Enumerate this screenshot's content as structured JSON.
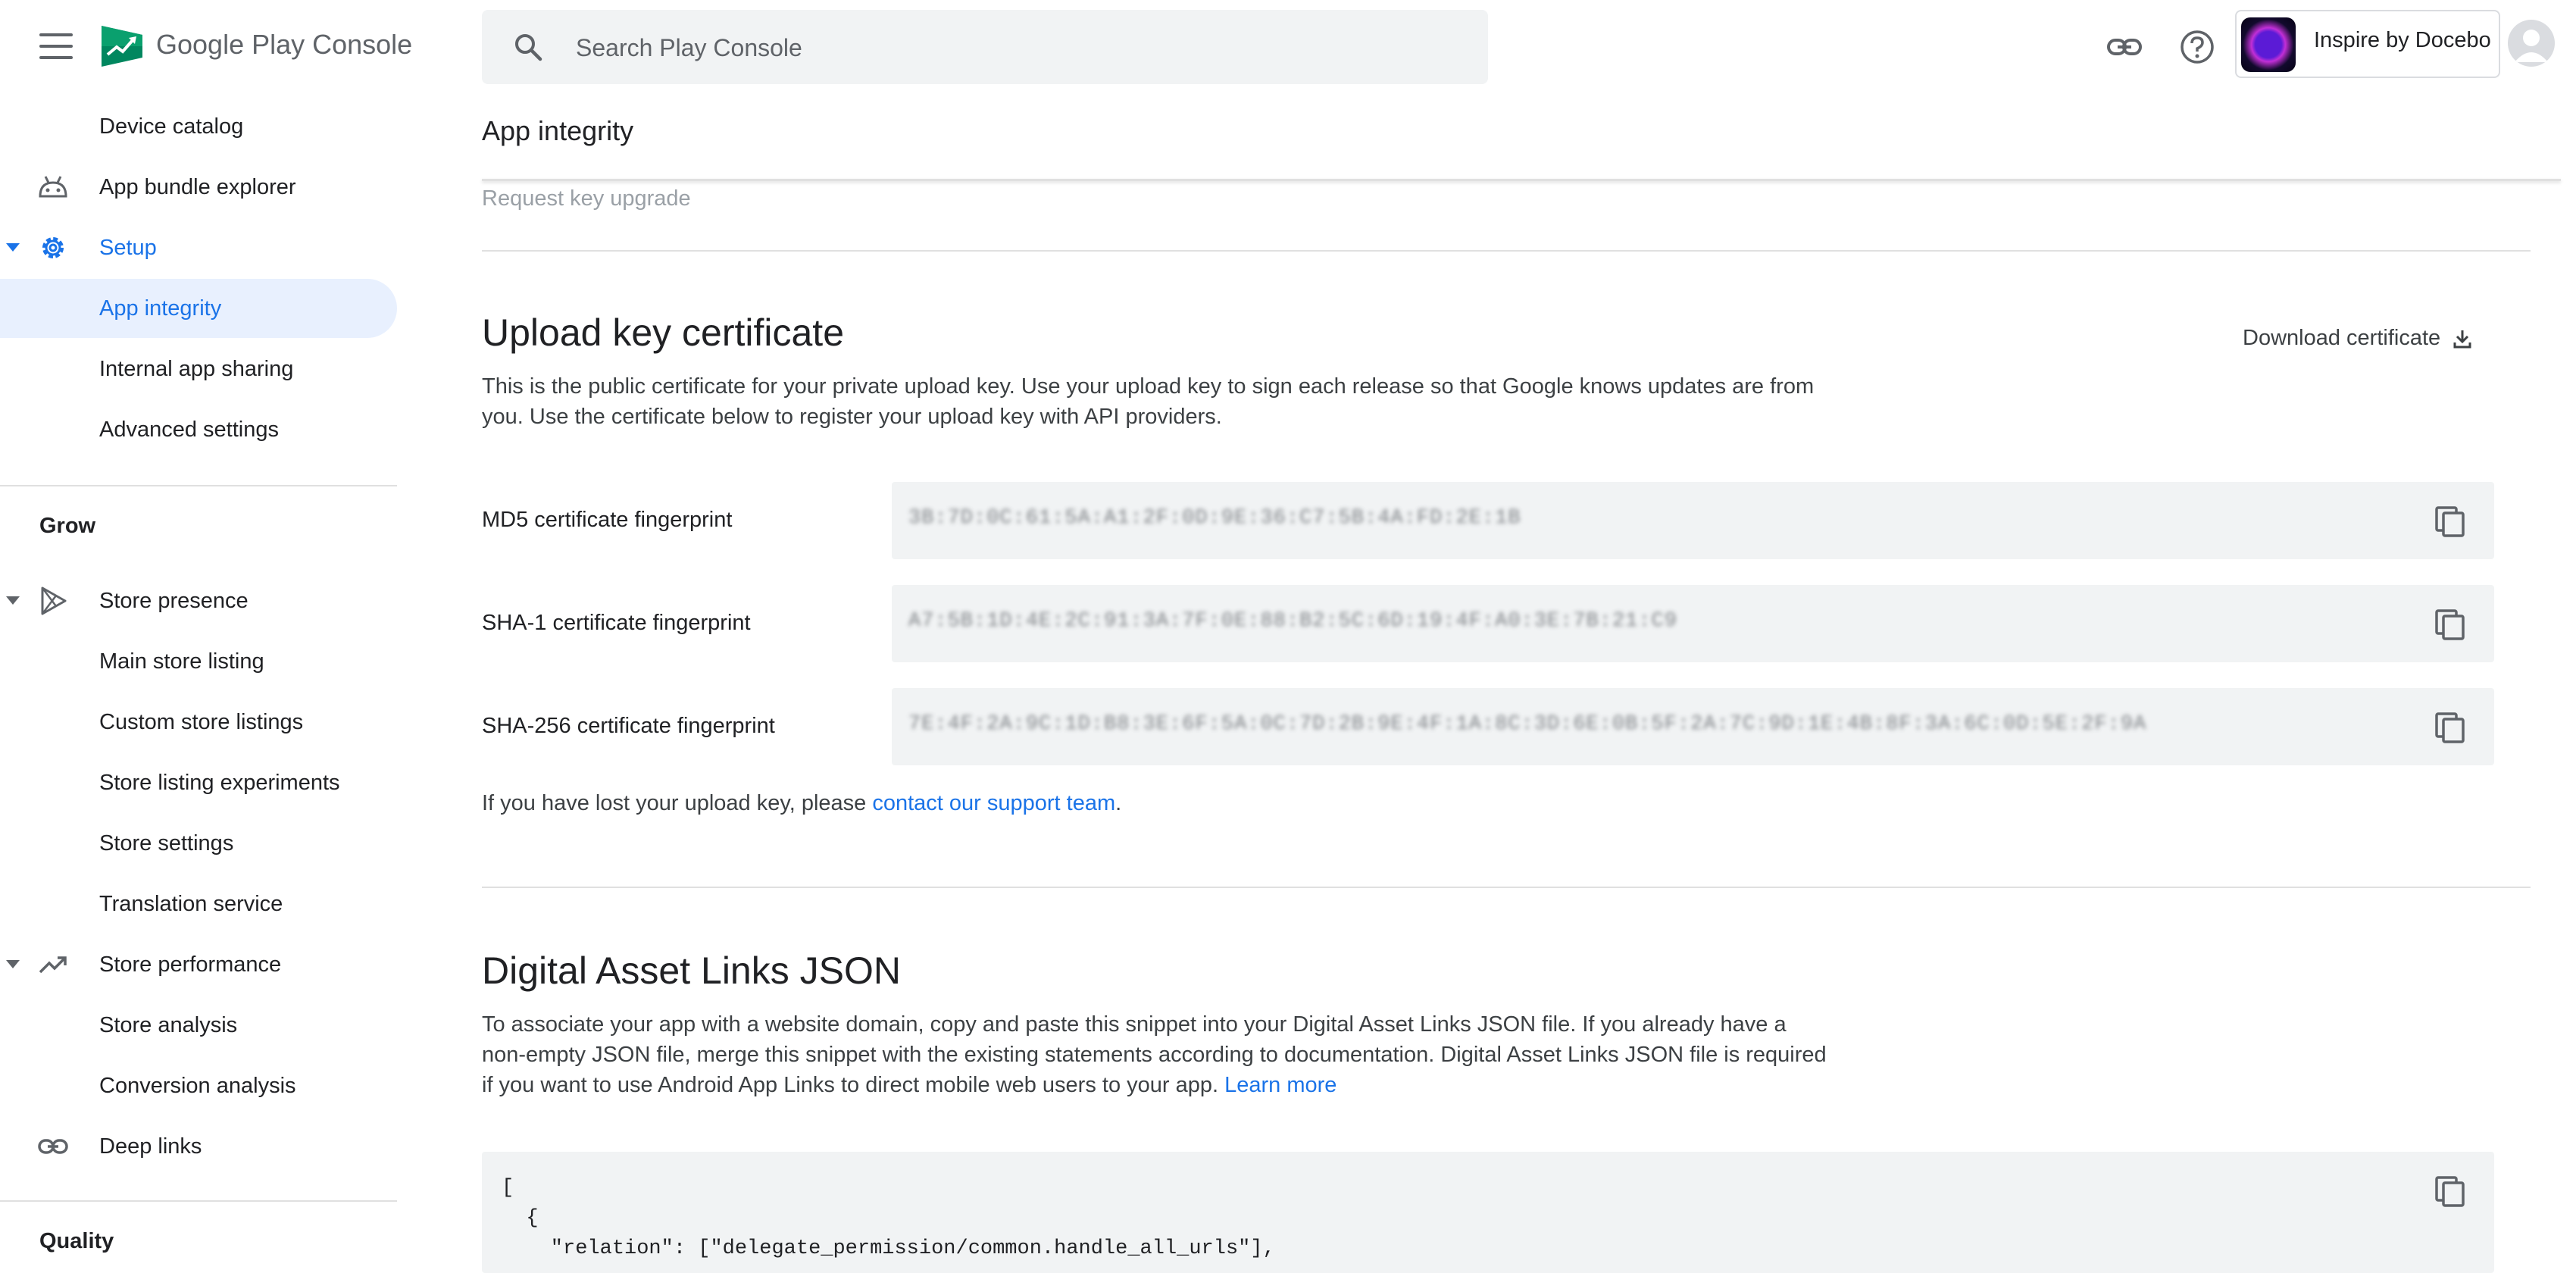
{
  "brand": {
    "name": "Google Play Console"
  },
  "sidebar": {
    "items": [
      {
        "label": "Device catalog"
      },
      {
        "label": "App bundle explorer"
      },
      {
        "label": "Setup"
      },
      {
        "label": "App integrity"
      },
      {
        "label": "Internal app sharing"
      },
      {
        "label": "Advanced settings"
      },
      {
        "label": "Store presence"
      },
      {
        "label": "Main store listing"
      },
      {
        "label": "Custom store listings"
      },
      {
        "label": "Store listing experiments"
      },
      {
        "label": "Store settings"
      },
      {
        "label": "Translation service"
      },
      {
        "label": "Store performance"
      },
      {
        "label": "Store analysis"
      },
      {
        "label": "Conversion analysis"
      },
      {
        "label": "Deep links"
      }
    ],
    "sections": {
      "grow": "Grow",
      "quality": "Quality"
    }
  },
  "search": {
    "placeholder": "Search Play Console"
  },
  "account": {
    "app_name": "Inspire by Docebo"
  },
  "page": {
    "title": "App integrity",
    "request_key_upgrade": "Request key upgrade"
  },
  "upload_key": {
    "title": "Upload key certificate",
    "description": "This is the public certificate for your private upload key. Use your upload key to sign each release so that Google knows updates are from you. Use the certificate below to register your upload key with API providers.",
    "download_label": "Download certificate",
    "fingerprints": [
      {
        "label": "MD5 certificate fingerprint",
        "value": "3B:7D:0C:61:5A:A1:2F:0D:9E:36:C7:5B:4A:FD:2E:1B"
      },
      {
        "label": "SHA-1 certificate fingerprint",
        "value": "A7:5B:1D:4E:2C:91:3A:7F:0E:88:B2:5C:6D:19:4F:A0:3E:7B:21:C9"
      },
      {
        "label": "SHA-256 certificate fingerprint",
        "value": "7E:4F:2A:9C:1D:B8:3E:6F:5A:0C:7D:2B:9E:4F:1A:8C:3D:6E:0B:5F:2A:7C:9D:1E:4B:8F:3A:6C:0D:5E:2F:9A"
      }
    ],
    "lost_key_text": "If you have lost your upload key, please ",
    "lost_key_link": "contact our support team",
    "lost_key_end": "."
  },
  "asset_links": {
    "title": "Digital Asset Links JSON",
    "description": "To associate your app with a website domain, copy and paste this snippet into your Digital Asset Links JSON file. If you already have a non-empty JSON file, merge this snippet with the existing statements according to documentation. Digital Asset Links JSON file is required if you want to use Android App Links to direct mobile web users to your app. ",
    "learn_more": "Learn more",
    "code": "[\n  {\n    \"relation\": [\"delegate_permission/common.handle_all_urls\"],"
  },
  "colors": {
    "accent": "#1a73e8",
    "active_bg": "#e8f0fe",
    "surface": "#f1f3f4"
  }
}
